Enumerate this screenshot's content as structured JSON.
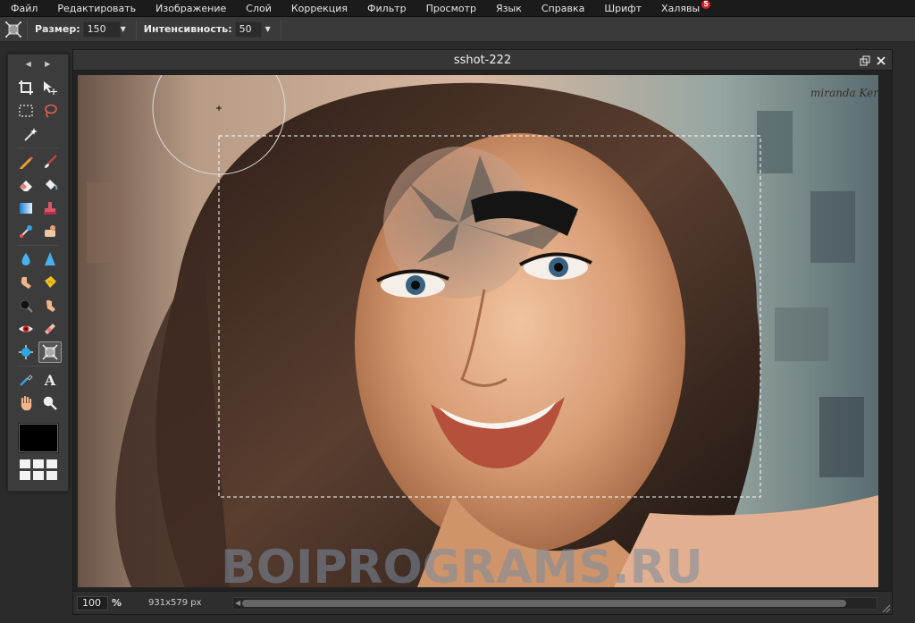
{
  "menu": [
    {
      "label": "Файл"
    },
    {
      "label": "Редактировать"
    },
    {
      "label": "Изображение"
    },
    {
      "label": "Слой"
    },
    {
      "label": "Коррекция"
    },
    {
      "label": "Фильтр"
    },
    {
      "label": "Просмотр"
    },
    {
      "label": "Язык"
    },
    {
      "label": "Справка"
    },
    {
      "label": "Шрифт"
    },
    {
      "label": "Халявы",
      "badge": "5"
    }
  ],
  "options": {
    "tool_icon": "pinch-warp-icon",
    "size_label": "Размер:",
    "size_value": "150",
    "intensity_label": "Интенсивность:",
    "intensity_value": "50"
  },
  "toolbox": {
    "tools": [
      [
        "crop-icon",
        "move-icon"
      ],
      [
        "marquee-select-icon",
        "lasso-icon"
      ],
      [
        "magic-wand-icon"
      ],
      [
        "pencil-icon",
        "brush-icon"
      ],
      [
        "eraser-icon",
        "paint-bucket-icon"
      ],
      [
        "gradient-icon",
        "clone-stamp-icon"
      ],
      [
        "color-replace-icon",
        "heal-icon"
      ],
      [
        "blur-icon",
        "sharpen-icon"
      ],
      [
        "smudge-icon",
        "sponge-icon"
      ],
      [
        "burn-icon",
        "dodge-icon"
      ],
      [
        "red-eye-icon",
        "spot-heal-icon"
      ],
      [
        "bloat-icon",
        "pinch-icon"
      ],
      [
        "color-picker-icon",
        "type-icon"
      ],
      [
        "hand-icon",
        "zoom-icon"
      ]
    ],
    "active_tool": "pinch-icon",
    "primary_color": "#000000"
  },
  "document": {
    "title": "sshot-222",
    "zoom": "100",
    "zoom_unit": "%",
    "dimensions": "931x579 px",
    "watermark": "BOIPROGRAMS.RU",
    "signature": "miranda Ker"
  },
  "colors": {
    "menubar_bg": "#1b1b1b",
    "toolbar_bg": "#3a3a3a",
    "panel_bg": "#3c3c3c",
    "badge": "#d92020"
  }
}
